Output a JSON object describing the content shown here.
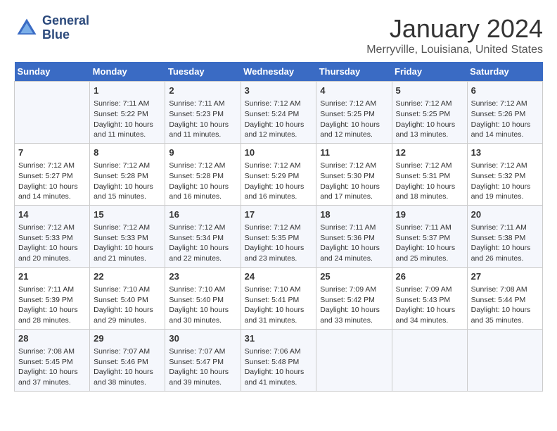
{
  "header": {
    "logo_line1": "General",
    "logo_line2": "Blue",
    "month": "January 2024",
    "location": "Merryville, Louisiana, United States"
  },
  "weekdays": [
    "Sunday",
    "Monday",
    "Tuesday",
    "Wednesday",
    "Thursday",
    "Friday",
    "Saturday"
  ],
  "weeks": [
    [
      {
        "day": "",
        "info": ""
      },
      {
        "day": "1",
        "info": "Sunrise: 7:11 AM\nSunset: 5:22 PM\nDaylight: 10 hours\nand 11 minutes."
      },
      {
        "day": "2",
        "info": "Sunrise: 7:11 AM\nSunset: 5:23 PM\nDaylight: 10 hours\nand 11 minutes."
      },
      {
        "day": "3",
        "info": "Sunrise: 7:12 AM\nSunset: 5:24 PM\nDaylight: 10 hours\nand 12 minutes."
      },
      {
        "day": "4",
        "info": "Sunrise: 7:12 AM\nSunset: 5:25 PM\nDaylight: 10 hours\nand 12 minutes."
      },
      {
        "day": "5",
        "info": "Sunrise: 7:12 AM\nSunset: 5:25 PM\nDaylight: 10 hours\nand 13 minutes."
      },
      {
        "day": "6",
        "info": "Sunrise: 7:12 AM\nSunset: 5:26 PM\nDaylight: 10 hours\nand 14 minutes."
      }
    ],
    [
      {
        "day": "7",
        "info": "Sunrise: 7:12 AM\nSunset: 5:27 PM\nDaylight: 10 hours\nand 14 minutes."
      },
      {
        "day": "8",
        "info": "Sunrise: 7:12 AM\nSunset: 5:28 PM\nDaylight: 10 hours\nand 15 minutes."
      },
      {
        "day": "9",
        "info": "Sunrise: 7:12 AM\nSunset: 5:28 PM\nDaylight: 10 hours\nand 16 minutes."
      },
      {
        "day": "10",
        "info": "Sunrise: 7:12 AM\nSunset: 5:29 PM\nDaylight: 10 hours\nand 16 minutes."
      },
      {
        "day": "11",
        "info": "Sunrise: 7:12 AM\nSunset: 5:30 PM\nDaylight: 10 hours\nand 17 minutes."
      },
      {
        "day": "12",
        "info": "Sunrise: 7:12 AM\nSunset: 5:31 PM\nDaylight: 10 hours\nand 18 minutes."
      },
      {
        "day": "13",
        "info": "Sunrise: 7:12 AM\nSunset: 5:32 PM\nDaylight: 10 hours\nand 19 minutes."
      }
    ],
    [
      {
        "day": "14",
        "info": "Sunrise: 7:12 AM\nSunset: 5:33 PM\nDaylight: 10 hours\nand 20 minutes."
      },
      {
        "day": "15",
        "info": "Sunrise: 7:12 AM\nSunset: 5:33 PM\nDaylight: 10 hours\nand 21 minutes."
      },
      {
        "day": "16",
        "info": "Sunrise: 7:12 AM\nSunset: 5:34 PM\nDaylight: 10 hours\nand 22 minutes."
      },
      {
        "day": "17",
        "info": "Sunrise: 7:12 AM\nSunset: 5:35 PM\nDaylight: 10 hours\nand 23 minutes."
      },
      {
        "day": "18",
        "info": "Sunrise: 7:11 AM\nSunset: 5:36 PM\nDaylight: 10 hours\nand 24 minutes."
      },
      {
        "day": "19",
        "info": "Sunrise: 7:11 AM\nSunset: 5:37 PM\nDaylight: 10 hours\nand 25 minutes."
      },
      {
        "day": "20",
        "info": "Sunrise: 7:11 AM\nSunset: 5:38 PM\nDaylight: 10 hours\nand 26 minutes."
      }
    ],
    [
      {
        "day": "21",
        "info": "Sunrise: 7:11 AM\nSunset: 5:39 PM\nDaylight: 10 hours\nand 28 minutes."
      },
      {
        "day": "22",
        "info": "Sunrise: 7:10 AM\nSunset: 5:40 PM\nDaylight: 10 hours\nand 29 minutes."
      },
      {
        "day": "23",
        "info": "Sunrise: 7:10 AM\nSunset: 5:40 PM\nDaylight: 10 hours\nand 30 minutes."
      },
      {
        "day": "24",
        "info": "Sunrise: 7:10 AM\nSunset: 5:41 PM\nDaylight: 10 hours\nand 31 minutes."
      },
      {
        "day": "25",
        "info": "Sunrise: 7:09 AM\nSunset: 5:42 PM\nDaylight: 10 hours\nand 33 minutes."
      },
      {
        "day": "26",
        "info": "Sunrise: 7:09 AM\nSunset: 5:43 PM\nDaylight: 10 hours\nand 34 minutes."
      },
      {
        "day": "27",
        "info": "Sunrise: 7:08 AM\nSunset: 5:44 PM\nDaylight: 10 hours\nand 35 minutes."
      }
    ],
    [
      {
        "day": "28",
        "info": "Sunrise: 7:08 AM\nSunset: 5:45 PM\nDaylight: 10 hours\nand 37 minutes."
      },
      {
        "day": "29",
        "info": "Sunrise: 7:07 AM\nSunset: 5:46 PM\nDaylight: 10 hours\nand 38 minutes."
      },
      {
        "day": "30",
        "info": "Sunrise: 7:07 AM\nSunset: 5:47 PM\nDaylight: 10 hours\nand 39 minutes."
      },
      {
        "day": "31",
        "info": "Sunrise: 7:06 AM\nSunset: 5:48 PM\nDaylight: 10 hours\nand 41 minutes."
      },
      {
        "day": "",
        "info": ""
      },
      {
        "day": "",
        "info": ""
      },
      {
        "day": "",
        "info": ""
      }
    ]
  ]
}
